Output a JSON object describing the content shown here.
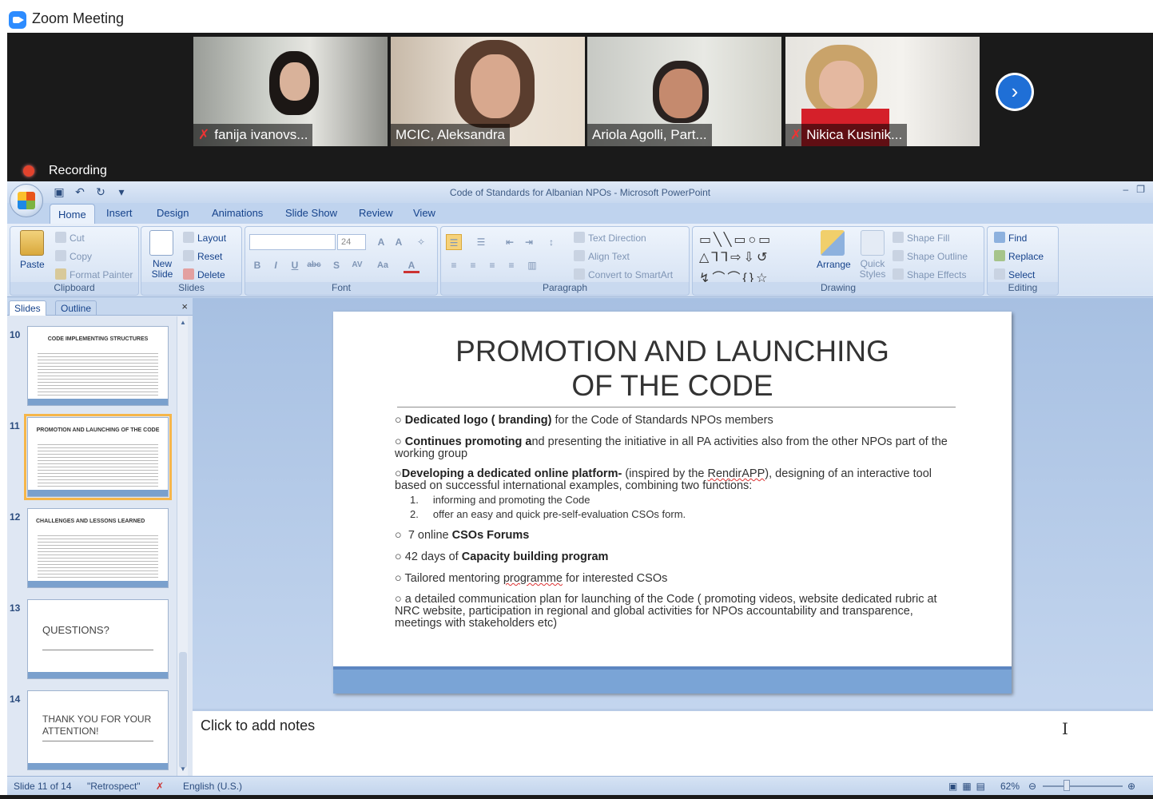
{
  "zoom": {
    "title": "Zoom Meeting",
    "recording": "Recording"
  },
  "participants": [
    {
      "name": "fanija ivanovs...",
      "muted": true
    },
    {
      "name": "MCIC, Aleksandra",
      "muted": false
    },
    {
      "name": "Ariola Agolli, Part...",
      "muted": false,
      "active": true
    },
    {
      "name": "Nikica Kusinik...",
      "muted": true
    }
  ],
  "ppt": {
    "window_title": "Code of Standards for Albanian NPOs - Microsoft PowerPoint",
    "tabs": [
      "Home",
      "Insert",
      "Design",
      "Animations",
      "Slide Show",
      "Review",
      "View"
    ],
    "ribbon": {
      "clipboard": {
        "label": "Clipboard",
        "paste": "Paste",
        "cut": "Cut",
        "copy": "Copy",
        "format_painter": "Format Painter"
      },
      "slides": {
        "label": "Slides",
        "new_slide": "New Slide",
        "layout": "Layout",
        "reset": "Reset",
        "delete": "Delete"
      },
      "font": {
        "label": "Font",
        "size": "24"
      },
      "paragraph": {
        "label": "Paragraph",
        "text_direction": "Text Direction",
        "align_text": "Align Text",
        "convert_smartart": "Convert to SmartArt"
      },
      "drawing": {
        "label": "Drawing",
        "arrange": "Arrange",
        "quick_styles": "Quick Styles",
        "shape_fill": "Shape Fill",
        "shape_outline": "Shape Outline",
        "shape_effects": "Shape Effects"
      },
      "editing": {
        "label": "Editing",
        "find": "Find",
        "replace": "Replace",
        "select": "Select"
      }
    },
    "panel_tabs": {
      "slides": "Slides",
      "outline": "Outline"
    },
    "thumbnails": [
      {
        "num": "10",
        "title": "CODE IMPLEMENTING STRUCTURES"
      },
      {
        "num": "11",
        "title": "PROMOTION AND LAUNCHING OF THE CODE"
      },
      {
        "num": "12",
        "title": "CHALLENGES AND LESSONS LEARNED"
      },
      {
        "num": "13",
        "title": "QUESTIONS?"
      },
      {
        "num": "14",
        "title": "THANK YOU FOR YOUR ATTENTION!"
      }
    ],
    "slide": {
      "title_line1": "PROMOTION AND LAUNCHING",
      "title_line2": "OF THE CODE",
      "b1_bold": "Dedicated logo ( branding)",
      "b1_rest": " for the Code of Standards NPOs members",
      "b2_bold": "Continues promoting a",
      "b2_rest": "nd presenting the initiative in all PA activities also from the other NPOs part of the working group",
      "b3_bold": "Developing a dedicated online platform-",
      "b3_rest1": " (inspired by the ",
      "b3_link": "RendirAPP",
      "b3_rest2": "), designing of an interactive tool based on successful international examples, combining two functions:",
      "sub1": "informing and promoting the Code",
      "sub2": "offer an easy and quick pre-self-evaluation CSOs form.",
      "b4_pre": "7 online ",
      "b4_bold": "CSOs Forums",
      "b5_pre": "42 days of ",
      "b5_bold": "Capacity building program",
      "b6_pre": "Tailored mentoring ",
      "b6_sq": "programme",
      "b6_rest": " for interested CSOs",
      "b7": "a detailed communication plan for launching of the Code ( promoting videos, website dedicated rubric at NRC website, participation in regional and global activities for NPOs accountability and transparence, meetings with stakeholders etc)"
    },
    "notes_placeholder": "Click to add notes",
    "status": {
      "slide": "Slide 11 of 14",
      "theme": "\"Retrospect\"",
      "language": "English (U.S.)",
      "zoom": "62%"
    }
  }
}
